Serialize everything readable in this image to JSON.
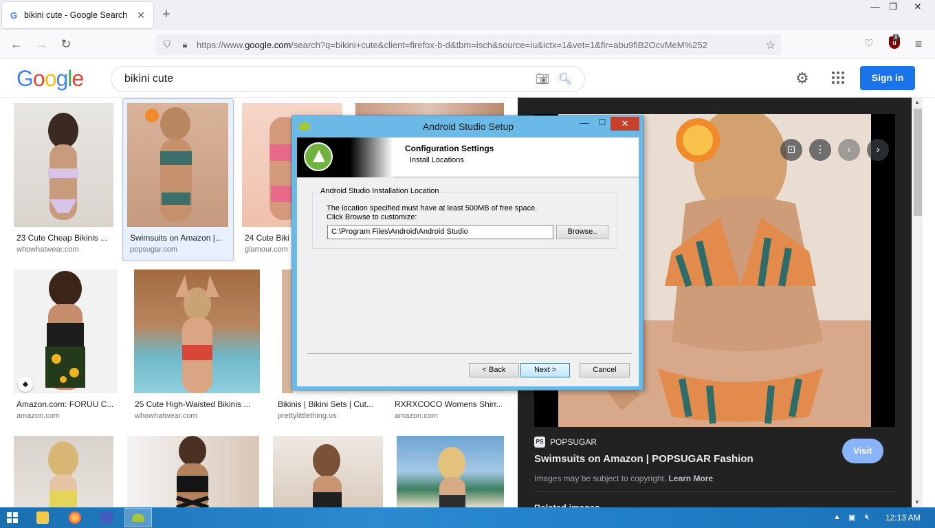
{
  "browser": {
    "tab": {
      "title": "bikini cute - Google Search",
      "favicon": "G"
    },
    "url_prefix": "https://www.",
    "url_domain": "google.com",
    "url_rest": "/search?q=bikini+cute&client=firefox-b-d&tbm=isch&source=iu&ictx=1&vet=1&fir=abu9fiB2OcvMeM%252",
    "extension_count": "8"
  },
  "google": {
    "logo": [
      "G",
      "o",
      "o",
      "g",
      "l",
      "e"
    ],
    "logo_colors": [
      "#4285f4",
      "#ea4335",
      "#fbbc05",
      "#4285f4",
      "#34a853",
      "#ea4335"
    ],
    "query": "bikini cute",
    "signin_label": "Sign in"
  },
  "results": [
    {
      "caption": "23 Cute Cheap Bikinis ...",
      "source": "whowhatwear.com"
    },
    {
      "caption": "Swimsuits on Amazon |...",
      "source": "popsugar.com"
    },
    {
      "caption": "24 Cute Biki",
      "source": "glamour.com"
    },
    {
      "caption": "Amazon.com: FORUU C...",
      "source": "amazon.com"
    },
    {
      "caption": "25 Cute High-Waisted Bikinis ...",
      "source": "whowhatwear.com"
    },
    {
      "caption": "Bikinis | Bikini Sets | Cut...",
      "source": "prettylittlething.us"
    },
    {
      "caption": "RXRXCOCO Womens Shirr...",
      "source": "amazon.com"
    }
  ],
  "preview": {
    "source_badge": "PS",
    "source_name": "POPSUGAR",
    "title": "Swimsuits on Amazon | POPSUGAR Fashion",
    "visit_label": "Visit",
    "copyright_text": "Images may be subject to copyright.",
    "learn_more": "Learn More",
    "related": "Related images"
  },
  "dialog": {
    "title": "Android Studio Setup",
    "heading": "Configuration Settings",
    "subheading": "Install Locations",
    "group_label": "Android Studio Installation Location",
    "line1": "The location specified must have at least 500MB of free space.",
    "line2": "Click Browse to customize:",
    "path": "C:\\Program Files\\Android\\Android Studio",
    "browse_label": "Browse..",
    "back_label": "< Back",
    "next_label": "Next >",
    "cancel_label": "Cancel"
  },
  "taskbar": {
    "clock": "12:13 AM"
  }
}
